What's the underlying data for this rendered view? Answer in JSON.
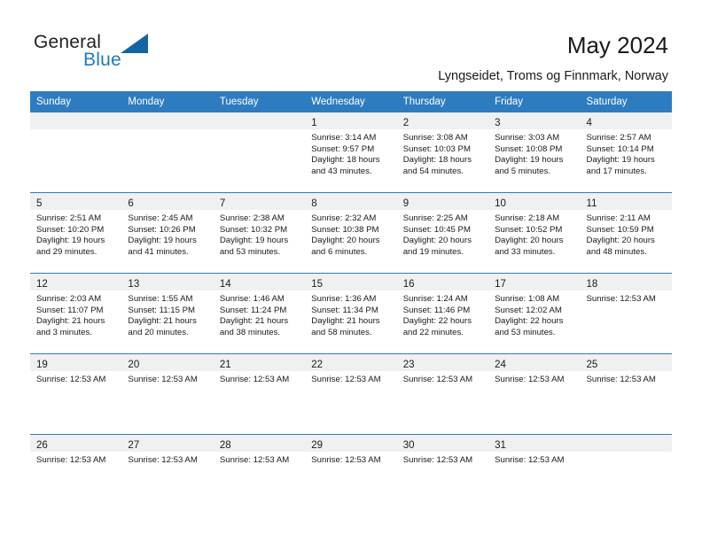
{
  "branding": {
    "logo_text_primary": "General",
    "logo_text_secondary": "Blue",
    "logo_accent_color": "#1464a5"
  },
  "header": {
    "title": "May 2024",
    "subtitle": "Lyngseidet, Troms og Finnmark, Norway",
    "header_bg_color": "#2e7cc0",
    "daynum_strip_color": "#f0f0f0"
  },
  "calendar": {
    "weekday_headers": [
      "Sunday",
      "Monday",
      "Tuesday",
      "Wednesday",
      "Thursday",
      "Friday",
      "Saturday"
    ],
    "weeks": [
      [
        {
          "day": "",
          "lines": []
        },
        {
          "day": "",
          "lines": []
        },
        {
          "day": "",
          "lines": []
        },
        {
          "day": "1",
          "lines": [
            "Sunrise: 3:14 AM",
            "Sunset: 9:57 PM",
            "Daylight: 18 hours",
            "and 43 minutes."
          ]
        },
        {
          "day": "2",
          "lines": [
            "Sunrise: 3:08 AM",
            "Sunset: 10:03 PM",
            "Daylight: 18 hours",
            "and 54 minutes."
          ]
        },
        {
          "day": "3",
          "lines": [
            "Sunrise: 3:03 AM",
            "Sunset: 10:08 PM",
            "Daylight: 19 hours",
            "and 5 minutes."
          ]
        },
        {
          "day": "4",
          "lines": [
            "Sunrise: 2:57 AM",
            "Sunset: 10:14 PM",
            "Daylight: 19 hours",
            "and 17 minutes."
          ]
        }
      ],
      [
        {
          "day": "5",
          "lines": [
            "Sunrise: 2:51 AM",
            "Sunset: 10:20 PM",
            "Daylight: 19 hours",
            "and 29 minutes."
          ]
        },
        {
          "day": "6",
          "lines": [
            "Sunrise: 2:45 AM",
            "Sunset: 10:26 PM",
            "Daylight: 19 hours",
            "and 41 minutes."
          ]
        },
        {
          "day": "7",
          "lines": [
            "Sunrise: 2:38 AM",
            "Sunset: 10:32 PM",
            "Daylight: 19 hours",
            "and 53 minutes."
          ]
        },
        {
          "day": "8",
          "lines": [
            "Sunrise: 2:32 AM",
            "Sunset: 10:38 PM",
            "Daylight: 20 hours",
            "and 6 minutes."
          ]
        },
        {
          "day": "9",
          "lines": [
            "Sunrise: 2:25 AM",
            "Sunset: 10:45 PM",
            "Daylight: 20 hours",
            "and 19 minutes."
          ]
        },
        {
          "day": "10",
          "lines": [
            "Sunrise: 2:18 AM",
            "Sunset: 10:52 PM",
            "Daylight: 20 hours",
            "and 33 minutes."
          ]
        },
        {
          "day": "11",
          "lines": [
            "Sunrise: 2:11 AM",
            "Sunset: 10:59 PM",
            "Daylight: 20 hours",
            "and 48 minutes."
          ]
        }
      ],
      [
        {
          "day": "12",
          "lines": [
            "Sunrise: 2:03 AM",
            "Sunset: 11:07 PM",
            "Daylight: 21 hours",
            "and 3 minutes."
          ]
        },
        {
          "day": "13",
          "lines": [
            "Sunrise: 1:55 AM",
            "Sunset: 11:15 PM",
            "Daylight: 21 hours",
            "and 20 minutes."
          ]
        },
        {
          "day": "14",
          "lines": [
            "Sunrise: 1:46 AM",
            "Sunset: 11:24 PM",
            "Daylight: 21 hours",
            "and 38 minutes."
          ]
        },
        {
          "day": "15",
          "lines": [
            "Sunrise: 1:36 AM",
            "Sunset: 11:34 PM",
            "Daylight: 21 hours",
            "and 58 minutes."
          ]
        },
        {
          "day": "16",
          "lines": [
            "Sunrise: 1:24 AM",
            "Sunset: 11:46 PM",
            "Daylight: 22 hours",
            "and 22 minutes."
          ]
        },
        {
          "day": "17",
          "lines": [
            "Sunrise: 1:08 AM",
            "Sunset: 12:02 AM",
            "Daylight: 22 hours",
            "and 53 minutes."
          ]
        },
        {
          "day": "18",
          "lines": [
            "Sunrise: 12:53 AM"
          ]
        }
      ],
      [
        {
          "day": "19",
          "lines": [
            "Sunrise: 12:53 AM"
          ]
        },
        {
          "day": "20",
          "lines": [
            "Sunrise: 12:53 AM"
          ]
        },
        {
          "day": "21",
          "lines": [
            "Sunrise: 12:53 AM"
          ]
        },
        {
          "day": "22",
          "lines": [
            "Sunrise: 12:53 AM"
          ]
        },
        {
          "day": "23",
          "lines": [
            "Sunrise: 12:53 AM"
          ]
        },
        {
          "day": "24",
          "lines": [
            "Sunrise: 12:53 AM"
          ]
        },
        {
          "day": "25",
          "lines": [
            "Sunrise: 12:53 AM"
          ]
        }
      ],
      [
        {
          "day": "26",
          "lines": [
            "Sunrise: 12:53 AM"
          ]
        },
        {
          "day": "27",
          "lines": [
            "Sunrise: 12:53 AM"
          ]
        },
        {
          "day": "28",
          "lines": [
            "Sunrise: 12:53 AM"
          ]
        },
        {
          "day": "29",
          "lines": [
            "Sunrise: 12:53 AM"
          ]
        },
        {
          "day": "30",
          "lines": [
            "Sunrise: 12:53 AM"
          ]
        },
        {
          "day": "31",
          "lines": [
            "Sunrise: 12:53 AM"
          ]
        },
        {
          "day": "",
          "lines": []
        }
      ]
    ]
  }
}
